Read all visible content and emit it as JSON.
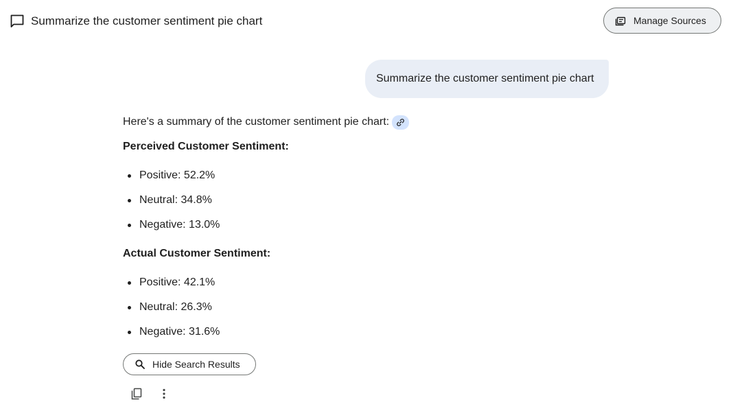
{
  "header": {
    "title": "Summarize the customer sentiment pie chart",
    "chat_icon": "chat-bubble-icon",
    "manage_sources_label": "Manage Sources",
    "manage_sources_icon": "sources-icon"
  },
  "user_message": {
    "text": "Summarize the customer sentiment pie chart"
  },
  "response": {
    "intro": "Here's a summary of the customer sentiment pie chart:",
    "source_chip_icon": "link-icon",
    "sections": [
      {
        "heading": "Perceived Customer Sentiment:",
        "items": [
          "Positive: 52.2%",
          "Neutral: 34.8%",
          "Negative: 13.0%"
        ]
      },
      {
        "heading": "Actual Customer Sentiment:",
        "items": [
          "Positive: 42.1%",
          "Neutral: 26.3%",
          "Negative: 31.6%"
        ]
      }
    ]
  },
  "actions": {
    "search_results_label": "Hide Search Results",
    "search_icon": "search-icon",
    "copy_icon": "copy-icon",
    "more_icon": "more-vertical-icon"
  },
  "colors": {
    "user_bubble": "#e9eef6",
    "source_chip": "#d3e3fd",
    "text": "#1f1f1f",
    "button_border": "#747775"
  }
}
